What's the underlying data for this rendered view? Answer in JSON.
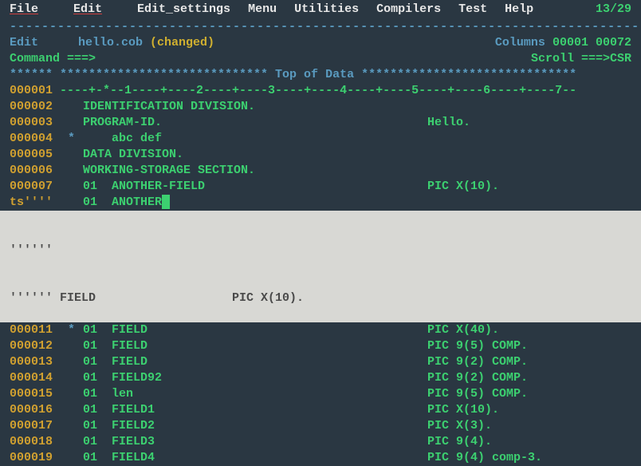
{
  "menubar": {
    "items": [
      "File",
      "Edit",
      "Edit_settings",
      "Menu",
      "Utilities",
      "Compilers",
      "Test",
      "Help"
    ],
    "position": "13/29"
  },
  "separator": "-------------------------------------------------------------------------------",
  "file": {
    "mode": "Edit",
    "filename": "hello.cob",
    "changed": "(changed)",
    "cols_label": "Columns",
    "cols_start": "00001",
    "cols_end": "00072"
  },
  "cmd": {
    "label": "Command  ===>",
    "scroll_label": "Scroll",
    "scroll_arrow": "===>",
    "scroll_val": "CSR"
  },
  "topdata": "****** ***************************** Top of Data ******************************",
  "ruler": {
    "num": "000001",
    "text": " ----+-*--1----+----2----+----3----+----4----+----5----+----6----+----7--"
  },
  "lines": [
    {
      "num": "000002",
      "star": "",
      "text": "IDENTIFICATION DIVISION.",
      "pic": ""
    },
    {
      "num": "000003",
      "star": "",
      "text": "PROGRAM-ID.",
      "pic": "Hello."
    },
    {
      "num": "000004",
      "star": "*",
      "text": "    abc def",
      "pic": ""
    },
    {
      "num": "000005",
      "star": "",
      "text": "DATA DIVISION.",
      "pic": ""
    },
    {
      "num": "000006",
      "star": "",
      "text": "WORKING-STORAGE SECTION.",
      "pic": ""
    },
    {
      "num": "000007",
      "star": "",
      "text": "01  ANOTHER-FIELD",
      "pic": "PIC X(10)."
    },
    {
      "num": "ts''''",
      "star": "",
      "text": "01  ANOTHER",
      "pic": "",
      "cursor": true
    }
  ],
  "highlight": [
    "''''''",
    "'''''' FIELD                   PIC X(10)."
  ],
  "lines2": [
    {
      "num": "000011",
      "star": "*",
      "text": "01  FIELD",
      "pic": "PIC X(40)."
    },
    {
      "num": "000012",
      "star": "",
      "text": "01  FIELD",
      "pic": "PIC 9(5) COMP."
    },
    {
      "num": "000013",
      "star": "",
      "text": "01  FIELD",
      "pic": "PIC 9(2) COMP."
    },
    {
      "num": "000014",
      "star": "",
      "text": "01  FIELD92",
      "pic": "PIC 9(2) COMP."
    },
    {
      "num": "000015",
      "star": "",
      "text": "01  len",
      "pic": "PIC 9(5) COMP."
    },
    {
      "num": "000016",
      "star": "",
      "text": "01  FIELD1",
      "pic": "PIC X(10)."
    },
    {
      "num": "000017",
      "star": "",
      "text": "01  FIELD2",
      "pic": "PIC X(3)."
    },
    {
      "num": "000018",
      "star": "",
      "text": "01  FIELD3",
      "pic": "PIC 9(4)."
    },
    {
      "num": "000019",
      "star": "",
      "text": "01  FIELD4",
      "pic": "PIC 9(4) comp-3."
    }
  ]
}
